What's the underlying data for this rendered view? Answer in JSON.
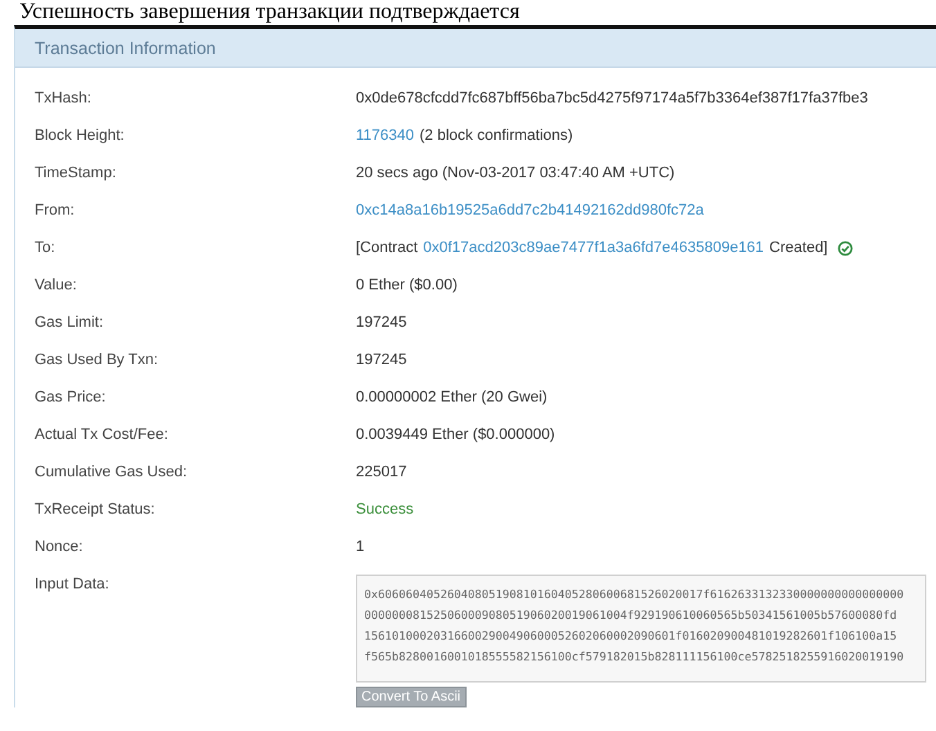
{
  "caption": "Успешность завершения транзакции подтверждается",
  "panel": {
    "title": "Transaction Information"
  },
  "rows": [
    {
      "kind": "text",
      "label": "TxHash:",
      "value": "0x0de678cfcdd7fc687bff56ba7bc5d4275f97174a5f7b3364ef387f17fa37fbe3"
    },
    {
      "kind": "block",
      "label": "Block Height:",
      "link": "1176340",
      "value": "(2 block confirmations)"
    },
    {
      "kind": "text",
      "label": "TimeStamp:",
      "value": "20 secs ago (Nov-03-2017 03:47:40 AM +UTC)"
    },
    {
      "kind": "link",
      "label": "From:",
      "value": "0xc14a8a16b19525a6dd7c2b41492162dd980fc72a"
    },
    {
      "kind": "contract",
      "label": "To:",
      "prefix": "[Contract",
      "link": "0x0f17acd203c89ae7477f1a3a6fd7e4635809e161",
      "suffix": "Created]"
    },
    {
      "kind": "text",
      "label": "Value:",
      "value": "0 Ether ($0.00)"
    },
    {
      "kind": "text",
      "label": "Gas Limit:",
      "value": "197245"
    },
    {
      "kind": "text",
      "label": "Gas Used By Txn:",
      "value": "197245"
    },
    {
      "kind": "text",
      "label": "Gas Price:",
      "value": "0.00000002 Ether (20 Gwei)"
    },
    {
      "kind": "text",
      "label": "Actual Tx Cost/Fee:",
      "value": "0.0039449 Ether ($0.000000)"
    },
    {
      "kind": "text",
      "label": "Cumulative Gas Used:",
      "value": "225017"
    },
    {
      "kind": "status",
      "label": "TxReceipt Status:",
      "value": "Success"
    },
    {
      "kind": "text",
      "label": "Nonce:",
      "value": "1"
    },
    {
      "kind": "input",
      "label": "Input Data:",
      "lines": [
        "0x60606040526040805190810160405280600681526020017f6162633132330000000000000000",
        "00000008152506000908051906020019061004f929190610060565b50341561005b57600080fd",
        "156101000203166002900490600052602060002090601f016020900481019282601f106100a15",
        "f565b8280016001018555582156100cf579182015b828111156100ce5782518255916020019190"
      ],
      "button": "Convert To Ascii"
    }
  ]
}
